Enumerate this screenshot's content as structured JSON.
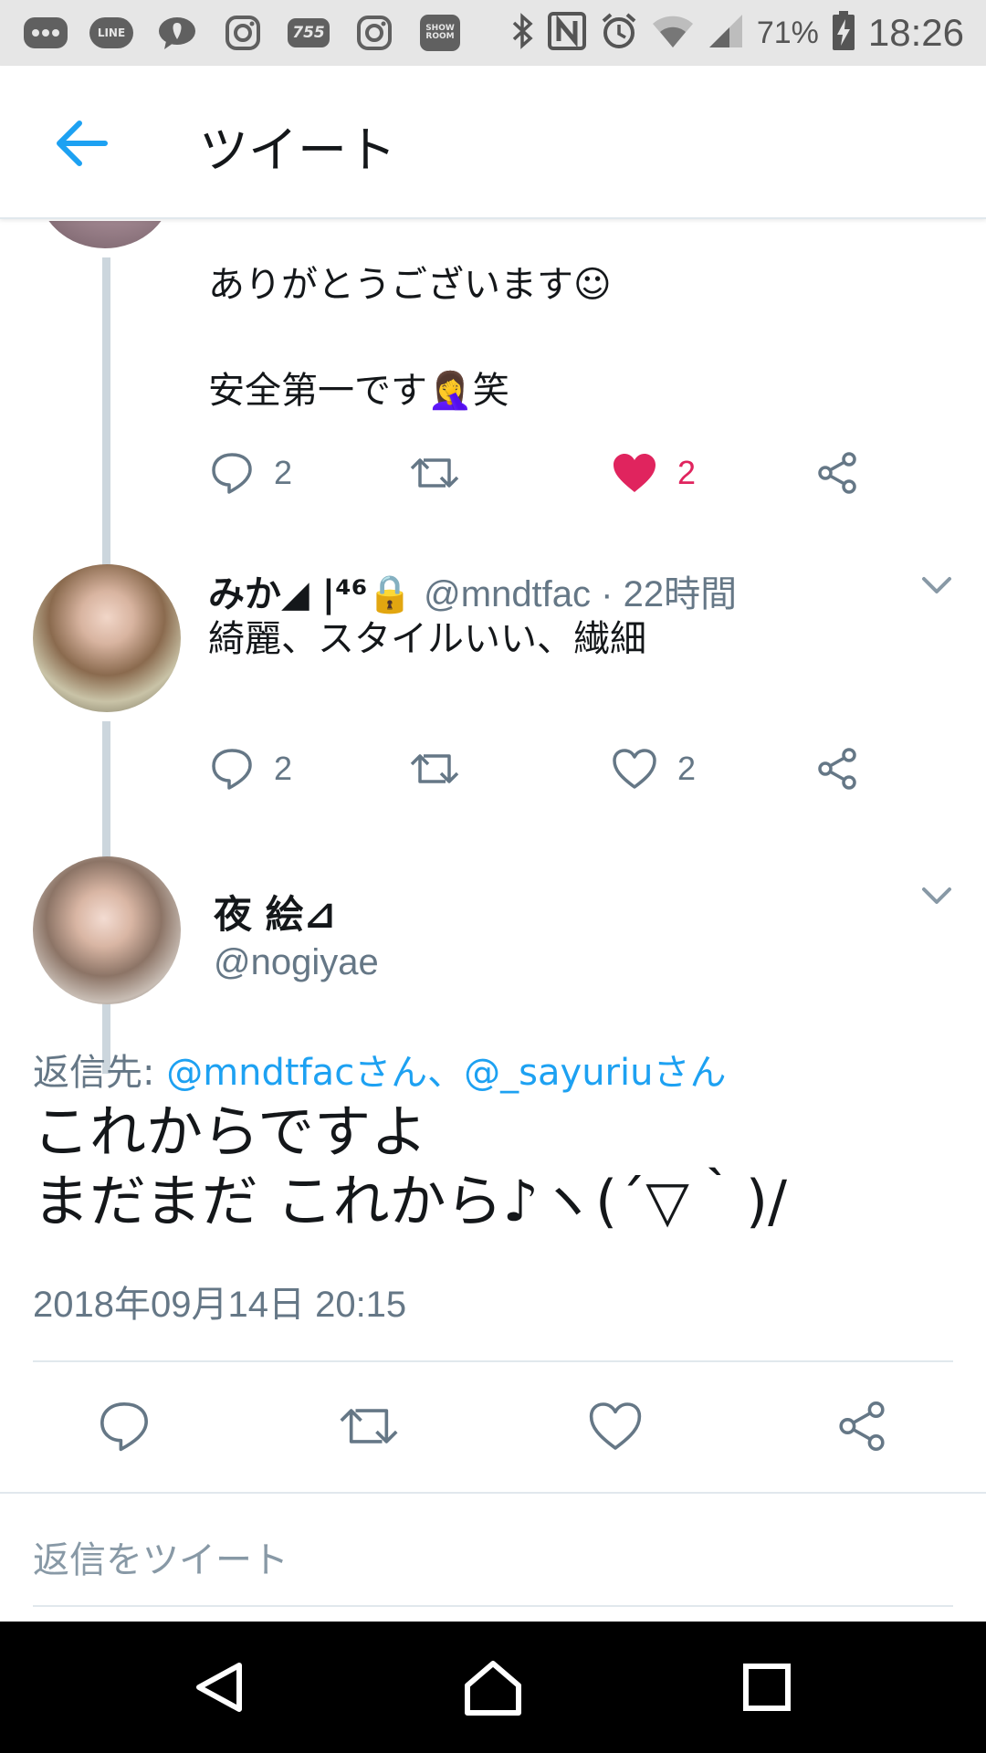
{
  "status_bar": {
    "apps": [
      "LINE",
      "755",
      "SHOW ROOM"
    ],
    "battery_percent": "71%",
    "time": "18:26"
  },
  "header": {
    "title": "ツイート"
  },
  "tweet_prev": {
    "line1": "ありがとうございます☺",
    "line2": "安全第一です🤦‍♀️笑",
    "reply_count": "2",
    "like_count": "2",
    "liked": true
  },
  "tweet_reply": {
    "display_name": "みか◢ |⁴⁶🔒",
    "handle_time": "@mndtfac · 22時間",
    "text": "綺麗、スタイルいい、繊細",
    "reply_count": "2",
    "like_count": "2"
  },
  "main_tweet": {
    "display_name": "夜 絵⊿",
    "handle": "@nogiyae",
    "reply_to_prefix": "返信先: ",
    "reply_to_links": "@mndtfacさん、@_sayuriuさん",
    "line1": "これからですよ",
    "line2": "まだまだ これから♪ヽ(´▽｀)/",
    "timestamp": "2018年09月14日 20:15"
  },
  "reply_box": {
    "placeholder": "返信をツイート"
  },
  "colors": {
    "accent": "#1da1f2",
    "like": "#e0245e",
    "muted": "#657786"
  }
}
